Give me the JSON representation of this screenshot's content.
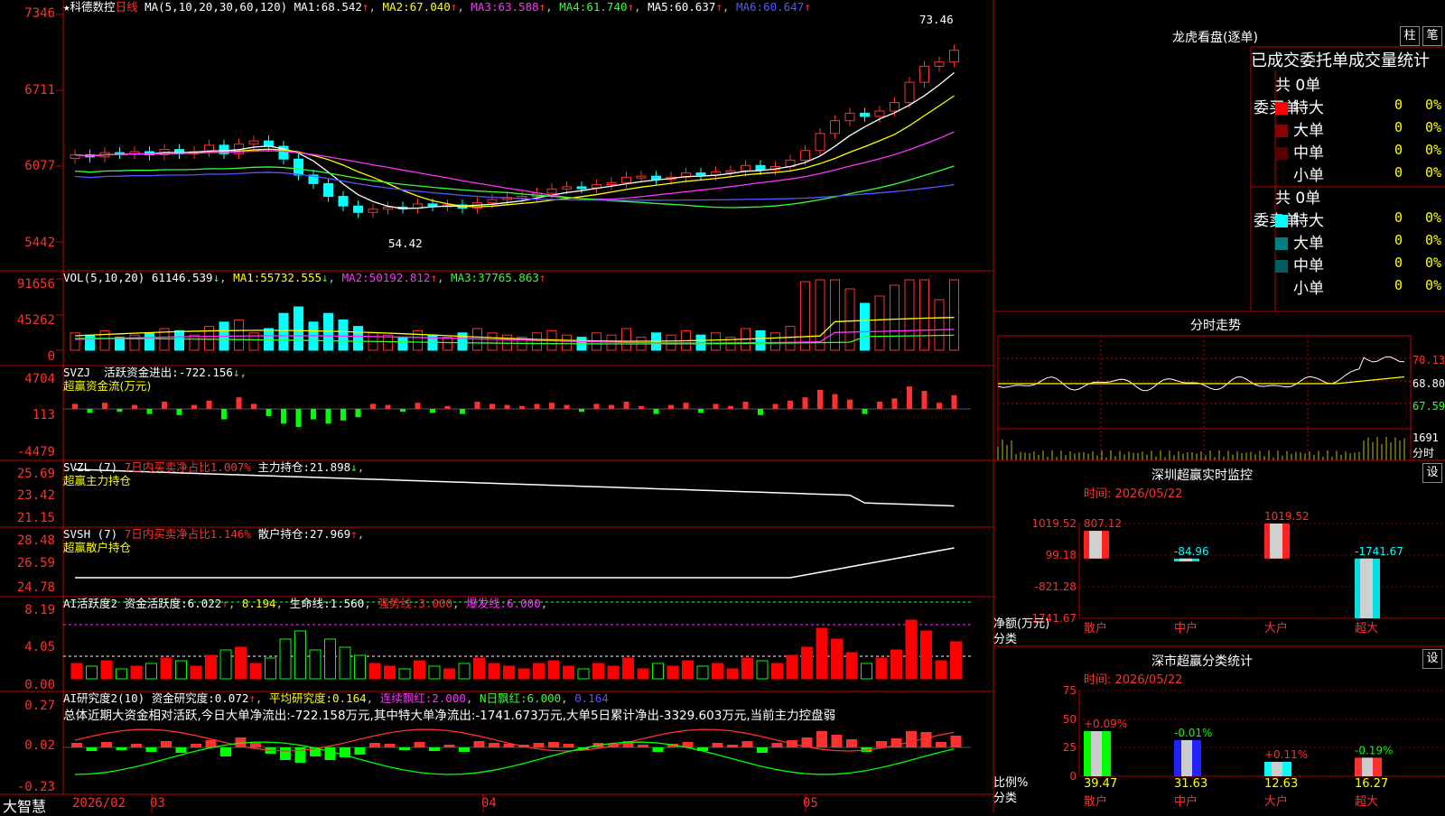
{
  "stock": {
    "name": "★科德数控",
    "period": "日线",
    "ma_params": "MA(5,10,20,30,60,120)",
    "ma": [
      {
        "label": "MA1:",
        "value": "68.542"
      },
      {
        "label": "MA2:",
        "value": "67.040"
      },
      {
        "label": "MA3:",
        "value": "63.588"
      },
      {
        "label": "MA4:",
        "value": "61.740"
      },
      {
        "label": "MA5:",
        "value": "60.637"
      },
      {
        "label": "MA6:",
        "value": "60.647"
      }
    ],
    "price_axis": [
      "7346",
      "6711",
      "6077",
      "5442"
    ],
    "high_label": "73.46",
    "low_label": "54.42"
  },
  "vol": {
    "header": "VOL(5,10,20)",
    "value": "61146.539",
    "ma": [
      {
        "label": "MA1:",
        "value": "55732.555"
      },
      {
        "label": "MA2:",
        "value": "50192.812"
      },
      {
        "label": "MA3:",
        "value": "37765.863"
      }
    ],
    "axis": [
      "91656",
      "45262",
      "0"
    ]
  },
  "svzj": {
    "name": "SVZJ",
    "label": "活跃资金进出:",
    "value": "-722.156",
    "sub": "超赢资金流(万元)",
    "axis": [
      "4704",
      "113",
      "-4479"
    ]
  },
  "svzl": {
    "name": "SVZL (7)",
    "ratio": "7日内买卖净占比1.007%",
    "label": "主力持仓:",
    "value": "21.898",
    "sub": "超赢主力持仓",
    "axis": [
      "25.69",
      "23.42",
      "21.15"
    ]
  },
  "svsh": {
    "name": "SVSH (7)",
    "ratio": "7日内买卖净占比1.146%",
    "label": "散户持仓:",
    "value": "27.969",
    "sub": "超赢散户持仓",
    "axis": [
      "28.48",
      "26.59",
      "24.78"
    ]
  },
  "ai_active": {
    "name": "AI活跃度2",
    "label": "资金活跃度:",
    "value": "6.022",
    "v2": "8.194",
    "life_label": "生命线:",
    "life": "1.560",
    "strong_label": "强势线:",
    "strong": "3.000",
    "burst_label": "爆发线:",
    "burst": "6.000",
    "axis": [
      "8.19",
      "4.05",
      "0.00"
    ]
  },
  "ai_research": {
    "name": "AI研究度2(10)",
    "label": "资金研究度:",
    "value": "0.072",
    "avg_label": "平均研究度:",
    "avg": "0.164",
    "red_label": "连续飘红:",
    "red": "2.000",
    "nred_label": "N日飘红:",
    "nred": "6.000",
    "extra": "0.164",
    "summary": "总体近期大资金相对活跃,今日大单净流出:-722.158万元,其中特大单净流出:-1741.673万元,大单5日累计净出-3329.603万元,当前主力控盘弱",
    "axis": [
      "0.27",
      "0.02",
      "-0.23"
    ]
  },
  "bottom": {
    "brand": "大智慧",
    "date": "2026/02",
    "months": [
      "03",
      "04",
      "05"
    ]
  },
  "lhb": {
    "title": "龙虎看盘(逐单)",
    "btn1": "柱",
    "btn2": "笔",
    "head": "已成交委托单成交量统计",
    "buy": {
      "label": "委买单",
      "total": "共 0单",
      "rows": [
        {
          "name": "特大",
          "n": "0",
          "p": "0%"
        },
        {
          "name": "大单",
          "n": "0",
          "p": "0%"
        },
        {
          "name": "中单",
          "n": "0",
          "p": "0%"
        },
        {
          "name": "小单",
          "n": "0",
          "p": "0%"
        }
      ]
    },
    "sell": {
      "label": "委卖单",
      "total": "共 0单",
      "rows": [
        {
          "name": "特大",
          "n": "0",
          "p": "0%"
        },
        {
          "name": "大单",
          "n": "0",
          "p": "0%"
        },
        {
          "name": "中单",
          "n": "0",
          "p": "0%"
        },
        {
          "name": "小单",
          "n": "0",
          "p": "0%"
        }
      ]
    }
  },
  "intraday": {
    "title": "分时走势",
    "axis": [
      "70.13",
      "68.80",
      "67.59"
    ],
    "vol": "1691",
    "vol_unit": "分时"
  },
  "monitor": {
    "title": "深圳超赢实时监控",
    "btn": "设",
    "time": "时间: 2026/05/22",
    "ylabel": "净额(万元)",
    "xlabel": "分类",
    "axis": [
      "1019.52",
      "99.18",
      "-821.28",
      "-1741.67"
    ],
    "bars": [
      {
        "cat": "散户",
        "value": 807.12,
        "label": "807.12"
      },
      {
        "cat": "中户",
        "value": -84.96,
        "label": "-84.96"
      },
      {
        "cat": "大户",
        "value": 1019.52,
        "label": "1019.52"
      },
      {
        "cat": "超大",
        "value": -1741.67,
        "label": "-1741.67"
      }
    ]
  },
  "classify": {
    "title": "深市超赢分类统计",
    "btn": "设",
    "time": "时间: 2026/05/22",
    "ylabel": "比例%",
    "xlabel": "分类",
    "axis": [
      "75",
      "50",
      "25",
      "0"
    ],
    "bars": [
      {
        "cat": "散户",
        "value": 39.47,
        "label": "39.47",
        "chg": "+0.09%"
      },
      {
        "cat": "中户",
        "value": 31.63,
        "label": "31.63",
        "chg": "-0.01%"
      },
      {
        "cat": "大户",
        "value": 12.63,
        "label": "12.63",
        "chg": "+0.11%"
      },
      {
        "cat": "超大",
        "value": 16.27,
        "label": "16.27",
        "chg": "-0.19%"
      }
    ]
  },
  "colors": {
    "up": "#ff3030",
    "down": "#00ffff",
    "grid": "#c00000"
  }
}
